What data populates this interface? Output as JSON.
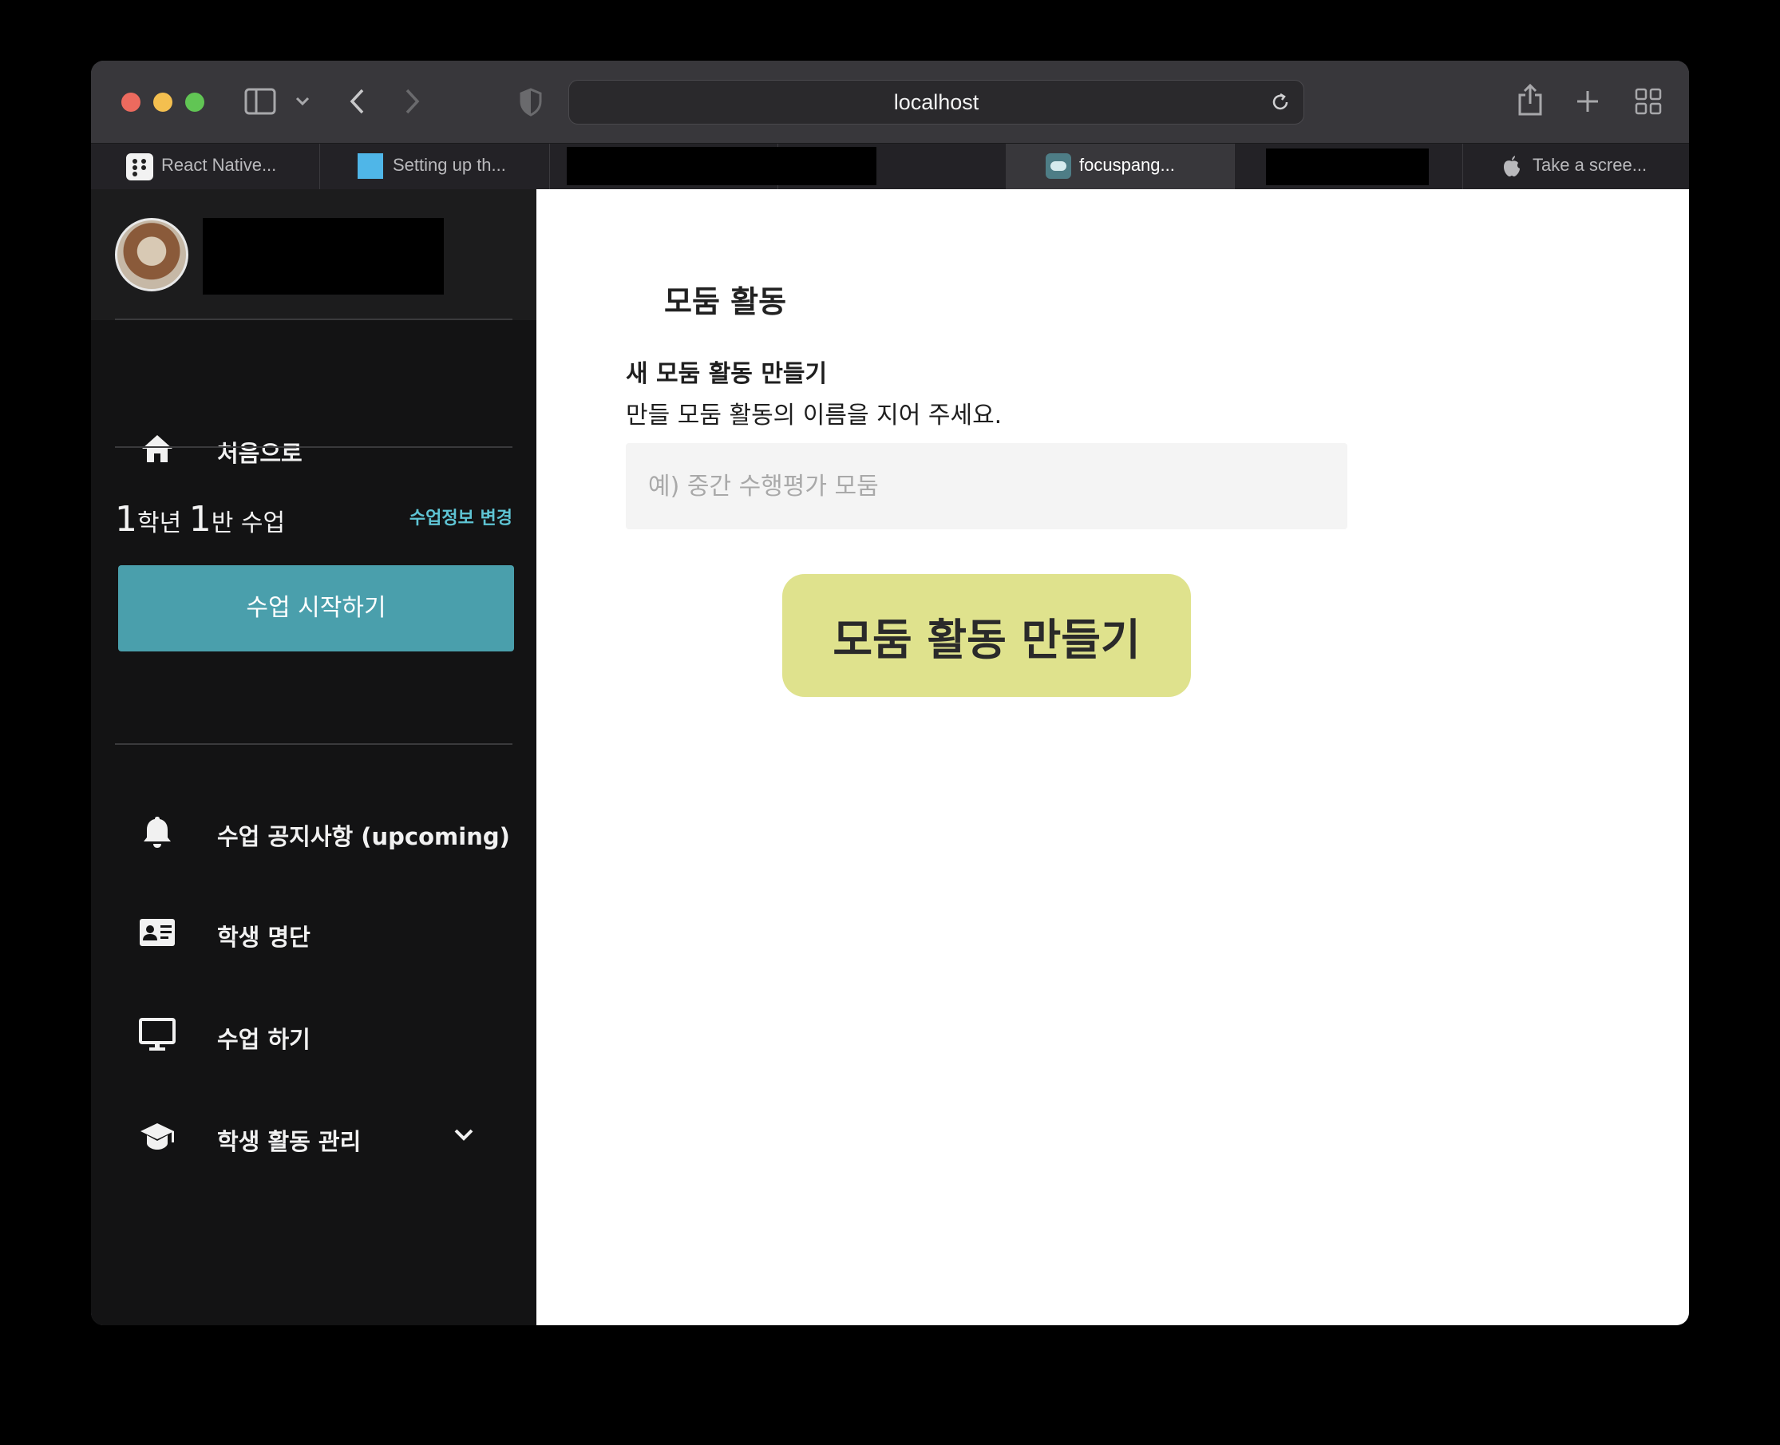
{
  "browser": {
    "url": "localhost",
    "tabs": [
      {
        "label": "React Native...",
        "icon": "expo-icon"
      },
      {
        "label": "Setting up th...",
        "icon": "blue-square-icon"
      },
      {
        "label": "",
        "icon": "redacted"
      },
      {
        "label": "focuspang...",
        "icon": "focuspang-icon",
        "active": true
      },
      {
        "label": "",
        "icon": "redacted"
      },
      {
        "label": "Take a scree...",
        "icon": "apple-icon"
      }
    ]
  },
  "sidebar": {
    "home_label": "처음으로",
    "class_grade_num": "1",
    "class_grade_suffix": "학년 ",
    "class_num": "1",
    "class_suffix": "반 수업",
    "change_info": "수업정보 변경",
    "start_class": "수업 시작하기",
    "items": [
      {
        "label": "수업 공지사항 (upcoming)",
        "icon": "bell-icon"
      },
      {
        "label": "학생 명단",
        "icon": "id-card-icon"
      },
      {
        "label": "수업 하기",
        "icon": "monitor-icon"
      },
      {
        "label": "학생 활동 관리",
        "icon": "graduation-cap-icon"
      }
    ]
  },
  "main": {
    "title": "모둠 활동",
    "form_title": "새 모둠 활동 만들기",
    "form_desc": "만들 모둠 활동의 이름을 지어 주세요.",
    "input_placeholder": "예) 중간 수행평가 모둠",
    "input_value": "",
    "create_button": "모둠 활동 만들기"
  }
}
